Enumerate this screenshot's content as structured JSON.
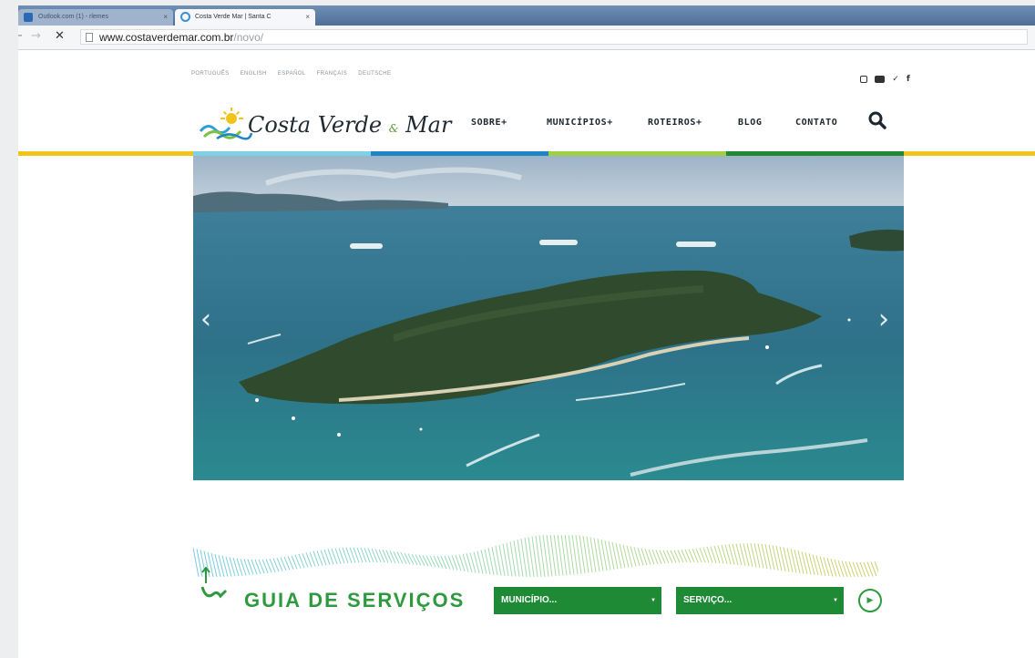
{
  "browser": {
    "tabs": [
      {
        "label": "Outlook.com (1) - rlemes",
        "active": false
      },
      {
        "label": "Costa Verde Mar | Santa C",
        "active": true
      }
    ],
    "tab_close_glyph": "×",
    "url_host": "www.costaverdemar.com.br",
    "url_path": "/novo/",
    "nav_icons": [
      "back-arrow-icon",
      "forward-arrow-icon",
      "stop-icon"
    ]
  },
  "site": {
    "languages": [
      "PORTUGUÊS",
      "ENGLISH",
      "ESPAÑOL",
      "FRANÇAIS",
      "DEUTSCHE"
    ],
    "social_icons": [
      "instagram-icon",
      "youtube-icon",
      "twitter-icon",
      "facebook-icon"
    ],
    "social_glyphs": {
      "twitter": "✓",
      "facebook": "f"
    },
    "brand": {
      "name_part1": "Costa Verde",
      "amp": "&",
      "name_part2": "Mar"
    },
    "nav": {
      "sobre": "SOBRE+",
      "municipios": "MUNICÍPIOS+",
      "roteiros": "ROTEIROS+",
      "blog": "BLOG",
      "contato": "CONTATO"
    },
    "colors": {
      "yellow": "#f1c41b",
      "strip": [
        "#7fd0e6",
        "#1f84c6",
        "#9fcf45",
        "#1f8a36"
      ],
      "green": "#2e9a3e"
    },
    "slider": {
      "prev": "‹",
      "next": "›"
    },
    "guia": {
      "title": "GUIA DE SERVIÇOS",
      "municipio_placeholder": "MUNICÍPIO...",
      "servico_placeholder": "SERVIÇO...",
      "caret": "▼",
      "go": "▶"
    }
  }
}
